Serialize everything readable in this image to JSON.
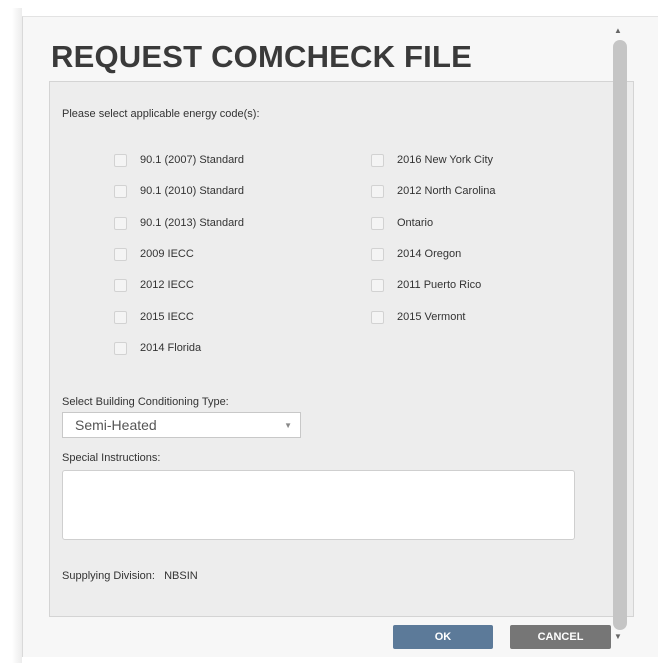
{
  "dialog": {
    "title": "REQUEST COMCHECK FILE",
    "prompt": "Please select applicable energy code(s):",
    "codes_left": [
      "90.1 (2007) Standard",
      "90.1 (2010) Standard",
      "90.1 (2013) Standard",
      "2009 IECC",
      "2012 IECC",
      "2015 IECC",
      "2014 Florida"
    ],
    "codes_right": [
      "2016 New York City",
      "2012 North Carolina",
      "Ontario",
      "2014 Oregon",
      "2011 Puerto Rico",
      "2015 Vermont"
    ],
    "conditioning_label": "Select Building Conditioning Type:",
    "conditioning_value": "Semi-Heated",
    "instructions_label": "Special Instructions:",
    "instructions_value": "",
    "supplying_label": "Supplying Division:",
    "supplying_value": "NBSIN",
    "ok_label": "OK",
    "cancel_label": "CANCEL"
  },
  "icons": {
    "dropdown": "chevron-down-icon",
    "scroll_up": "scroll-up-arrow-icon",
    "scroll_down": "scroll-down-arrow-icon"
  },
  "colors": {
    "ok_button": "#5c7a99",
    "cancel_button": "#767676",
    "panel": "#ededed"
  }
}
